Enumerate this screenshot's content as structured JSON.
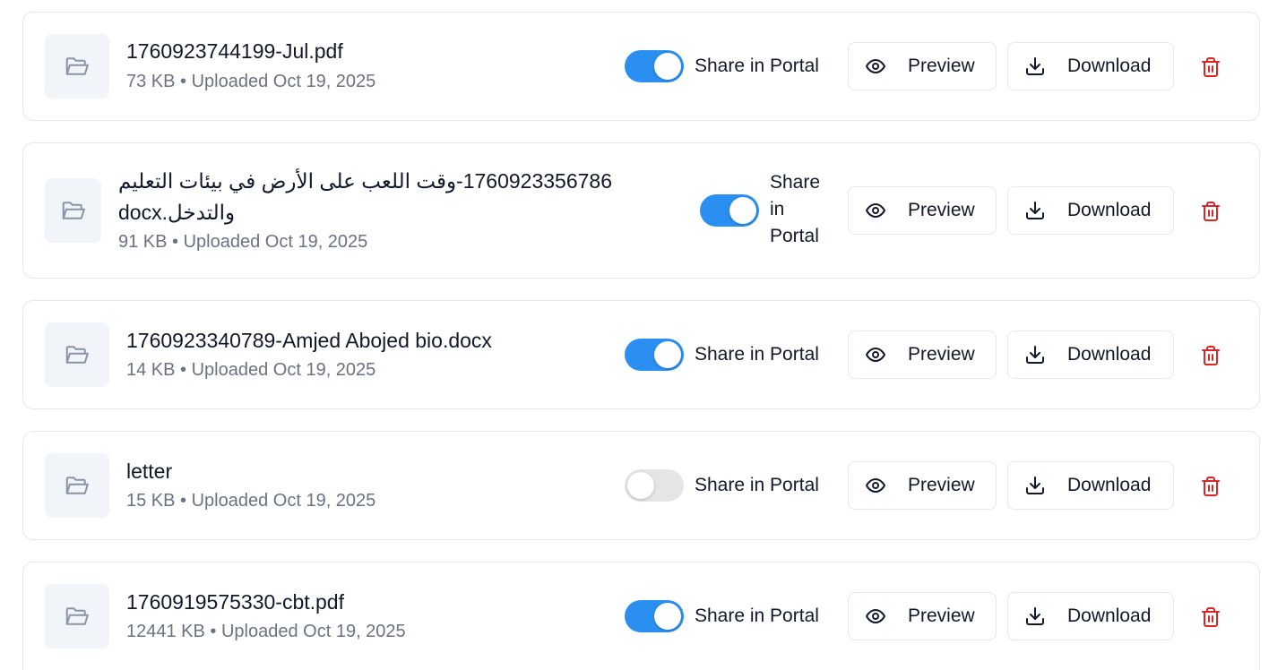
{
  "files": [
    {
      "name": "1760923744199-Jul.pdf",
      "meta": "73 KB • Uploaded Oct 19, 2025",
      "shared": true,
      "share_label": "Share in Portal",
      "preview_label": "Preview",
      "download_label": "Download"
    },
    {
      "name": "1760923356786-وقت اللعب على الأرض في بيئات التعليم والتدخل.docx",
      "meta": "91 KB • Uploaded Oct 19, 2025",
      "shared": true,
      "share_label": "Share in Portal",
      "preview_label": "Preview",
      "download_label": "Download"
    },
    {
      "name": "1760923340789-Amjed Abojed bio.docx",
      "meta": "14 KB • Uploaded Oct 19, 2025",
      "shared": true,
      "share_label": "Share in Portal",
      "preview_label": "Preview",
      "download_label": "Download"
    },
    {
      "name": "letter",
      "meta": "15 KB • Uploaded Oct 19, 2025",
      "shared": false,
      "share_label": "Share in Portal",
      "preview_label": "Preview",
      "download_label": "Download"
    },
    {
      "name": "1760919575330-cbt.pdf",
      "meta": "12441 KB • Uploaded Oct 19, 2025",
      "shared": true,
      "share_label": "Share in Portal",
      "preview_label": "Preview",
      "download_label": "Download"
    }
  ],
  "icons": {
    "file": "folder-open-icon",
    "preview": "eye-icon",
    "download": "download-icon",
    "delete": "trash-icon"
  },
  "colors": {
    "toggle_on": "#2b8ff2",
    "toggle_off": "#e5e5e5",
    "delete": "#dc2626",
    "meta_text": "#6b7280"
  }
}
